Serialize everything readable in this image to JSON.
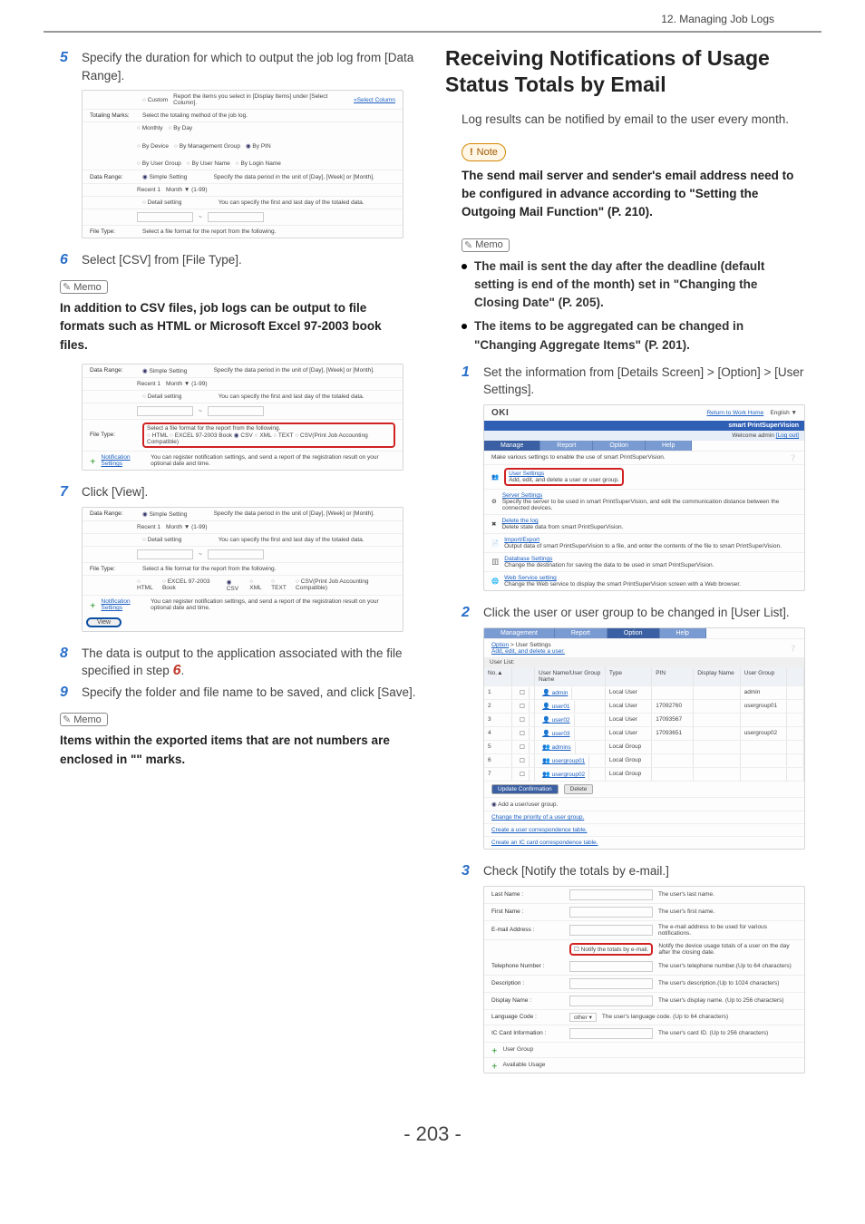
{
  "header": {
    "chapter": "12. Managing Job Logs"
  },
  "page_number": "- 203 -",
  "left": {
    "s5": {
      "num": "5",
      "text": "Specify the duration for which to output the job log from [Data Range]."
    },
    "s6": {
      "num": "6",
      "text": "Select [CSV] from [File Type]."
    },
    "memo1": "Memo",
    "bold1": "In addition to CSV files, job logs can be output to file formats such as HTML or Microsoft Excel 97-2003 book files.",
    "s7": {
      "num": "7",
      "text": "Click [View]."
    },
    "s8": {
      "num": "8",
      "text_a": "The data is output to the application associated with the file specified in step ",
      "text_b": "6",
      "text_c": "."
    },
    "s9": {
      "num": "9",
      "text": "Specify the folder and file name to be saved, and click [Save]."
    },
    "memo2": "Memo",
    "bold2": "Items within the exported items that are not numbers are enclosed in \"\" marks.",
    "shot1": {
      "custom_radio": "Custom",
      "custom_desc": "Report the items you select in [Display Items] under [Select Column].",
      "select_column_link": "»Select Column",
      "totaling_label": "Totaling Marks:",
      "totaling_desc": "Select the totaling method of the job log.",
      "opts": [
        "Monthly",
        "By Day",
        "By Device",
        "By Management Group",
        "By PIN",
        "By User Group",
        "By User Name",
        "By Login Name"
      ],
      "data_range_label": "Data Range:",
      "simple": "Simple Setting",
      "simple_desc": "Specify the data period in the unit of [Day], [Week] or [Month].",
      "recent": "Recent 1",
      "month_range": "Month ▼ (1-99)",
      "detail": "Detail setting",
      "detail_desc": "You can specify the first and last day of the totaled data.",
      "file_type_hint": "Select a file format for the report from the following."
    },
    "shot2": {
      "data_range_label": "Data Range:",
      "simple": "Simple Setting",
      "simple_desc": "Specify the data period in the unit of [Day], [Week] or [Month].",
      "recent": "Recent 1",
      "month_range": "Month ▼ (1-99)",
      "detail": "Detail setting",
      "detail_desc": "You can specify the first and last day of the totaled data.",
      "file_type_label": "File Type:",
      "file_type_hint": "Select a file format for the report from the following.",
      "formats": [
        "HTML",
        "EXCEL 97-2003 Book",
        "CSV",
        "XML",
        "TEXT",
        "CSV(Print Job Accounting Compatible)"
      ],
      "notif_label": "Notification Settings",
      "notif_desc": "You can register notification settings, and send a report of the registration result on your optional date and time."
    },
    "shot3": {
      "data_range_label": "Data Range:",
      "simple": "Simple Setting",
      "simple_desc": "Specify the data period in the unit of [Day], [Week] or [Month].",
      "recent": "Recent 1",
      "month_range": "Month ▼ (1-99)",
      "detail": "Detail setting",
      "detail_desc": "You can specify the first and last day of the totaled data.",
      "file_type_label": "File Type:",
      "file_type_hint": "Select a file format for the report from the following.",
      "formats": [
        "HTML",
        "EXCEL 97-2003 Book",
        "CSV",
        "XML",
        "TEXT",
        "CSV(Print Job Accounting Compatible)"
      ],
      "notif_label": "Notification Settings",
      "notif_desc": "You can register notification settings, and send a report of the registration result on your optional date and time.",
      "view_btn": "View"
    }
  },
  "right": {
    "title": "Receiving Notifications of Usage Status Totals by Email",
    "intro": "Log results can be notified by email to the user every month.",
    "note_badge": "Note",
    "note_bold": "The send mail server and sender's email address need to be configured in advance according to \"Setting the Outgoing Mail Function\" (P. 210).",
    "memo": "Memo",
    "bullets": [
      "The mail is sent the day after the deadline (default setting is end of the month) set in \"Changing the Closing Date\" (P. 205).",
      "The items to be aggregated can be changed in \"Changing Aggregate Items\" (P. 201)."
    ],
    "s1": {
      "num": "1",
      "text": "Set the information from [Details Screen] > [Option] > [User Settings]."
    },
    "s2": {
      "num": "2",
      "text": "Click the user or user group to be changed in [User List]."
    },
    "s3": {
      "num": "3",
      "text": "Check [Notify the totals by e-mail.]"
    },
    "shot1": {
      "logo": "OKI",
      "work_home": "Return to Work Home",
      "lang": "English  ▼",
      "banner": "smart PrintSuperVision",
      "welcome": "Welcome admin",
      "logout": "[Log out]",
      "tabs": [
        "Manage",
        "Report",
        "Option",
        "Help"
      ],
      "subtitle": "Make various settings to enable the use of smart PrintSuperVision.",
      "user_settings": "User Settings",
      "user_settings_desc": "Add, edit, and delete a user or user group.",
      "server": "Server Settings",
      "server_desc": "Specify the server to be used in smart PrintSuperVision, and edit the communication distance between the connected devices.",
      "delete_log": "Delete the log",
      "delete_log_desc": "Delete state data from smart PrintSuperVision.",
      "import": "Import/Export",
      "import_desc": "Output data of smart PrintSuperVision to a file, and enter the contents of the file to smart PrintSuperVision.",
      "db": "Database Settings",
      "db_desc": "Change the destination for saving the data to be used in smart PrintSuperVision.",
      "ws": "Web Service setting",
      "ws_desc": "Change the Web service to display the smart PrintSuperVision screen with a Web browser."
    },
    "shot2": {
      "tabs": [
        "Management",
        "Report",
        "Option",
        "Help"
      ],
      "bc1": "Option",
      "bc2": "User Settings",
      "sub_link": "Add, edit, and delete a user.",
      "list_title": "User List:",
      "columns": [
        "No.▲",
        "",
        "User Name/User Group Name",
        "Type",
        "PIN",
        "Display Name",
        "User Group",
        ""
      ],
      "rows": [
        {
          "no": "1",
          "cb": "",
          "name": "admin",
          "type": "Local User",
          "pin": "",
          "dn": "",
          "ug": "admin"
        },
        {
          "no": "2",
          "cb": "",
          "name": "user01",
          "type": "Local User",
          "pin": "17092760",
          "dn": "",
          "ug": "usergroup01"
        },
        {
          "no": "3",
          "cb": "",
          "name": "user02",
          "type": "Local User",
          "pin": "17093567",
          "dn": "",
          "ug": ""
        },
        {
          "no": "4",
          "cb": "",
          "name": "user03",
          "type": "Local User",
          "pin": "17093651",
          "dn": "",
          "ug": "usergroup02"
        },
        {
          "no": "5",
          "cb": "",
          "name": "admins",
          "type": "Local Group",
          "pin": "",
          "dn": "",
          "ug": ""
        },
        {
          "no": "6",
          "cb": "",
          "name": "usergroup01",
          "type": "Local Group",
          "pin": "",
          "dn": "",
          "ug": ""
        },
        {
          "no": "7",
          "cb": "",
          "name": "usergroup02",
          "type": "Local Group",
          "pin": "",
          "dn": "",
          "ug": ""
        }
      ],
      "update_btn": "Update Confirmation",
      "delete_btn": "Delete",
      "add_radio": "Add a user/user group.",
      "link1": "Change the priority of a user group.",
      "link2": "Create a user correspondence table.",
      "link3": "Create an IC card correspondence table."
    },
    "shot3": {
      "fields": [
        {
          "l": "Last Name :",
          "d": "The user's last name."
        },
        {
          "l": "First Name :",
          "d": "The user's first name."
        },
        {
          "l": "E-mail Address :",
          "d": "The e-mail address to be used for various notifications."
        }
      ],
      "notify_label": "Notify the totals by e-mail.",
      "notify_desc": "Notify the device usage totals of a user on the day after the closing date.",
      "fields2": [
        {
          "l": "Telephone Number :",
          "d": "The user's telephone number.(Up to 64 characters)"
        },
        {
          "l": "Description :",
          "d": "The user's description.(Up to 1024 characters)"
        },
        {
          "l": "Display Name :",
          "d": "The user's display name. (Up to 256 characters)"
        },
        {
          "l": "Language Code :",
          "v": "other",
          "d": "The user's language code. (Up to 64 characters)"
        },
        {
          "l": "IC Card Information :",
          "d": "The user's card ID. (Up to 256 characters)"
        }
      ],
      "user_group": "User Group",
      "avail_usage": "Available Usage"
    }
  }
}
